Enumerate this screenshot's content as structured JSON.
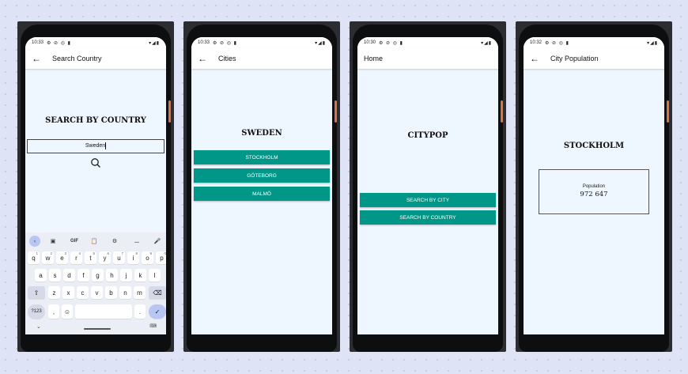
{
  "screens": [
    {
      "status": {
        "time": "10:33",
        "icons": "⚙ ⊘ ◎ ▮",
        "right": "▾◢▮"
      },
      "appbar": {
        "title": "Search Country"
      },
      "heading": "SEARCH BY COUNTRY",
      "search": {
        "value": "Sweden"
      },
      "keyboard": {
        "toolbar": [
          "GIF",
          "..."
        ],
        "row1": [
          [
            "q",
            "1"
          ],
          [
            "w",
            "2"
          ],
          [
            "e",
            "3"
          ],
          [
            "r",
            "4"
          ],
          [
            "t",
            "5"
          ],
          [
            "y",
            "6"
          ],
          [
            "u",
            "7"
          ],
          [
            "i",
            "8"
          ],
          [
            "o",
            "9"
          ],
          [
            "p",
            "0"
          ]
        ],
        "row2": [
          "a",
          "s",
          "d",
          "f",
          "g",
          "h",
          "j",
          "k",
          "l"
        ],
        "row3": [
          "z",
          "x",
          "c",
          "v",
          "b",
          "n",
          "m"
        ],
        "sym_label": "?123",
        "comma": ",",
        "period": "."
      }
    },
    {
      "status": {
        "time": "10:33",
        "icons": "⚙ ⊘ ◎ ▮",
        "right": "▾◢▮"
      },
      "appbar": {
        "title": "Cities"
      },
      "heading": "SWEDEN",
      "cities": [
        "STOCKHOLM",
        "GÖTEBORG",
        "MALMÖ"
      ]
    },
    {
      "status": {
        "time": "10:30",
        "icons": "⚙ ⊘ ◎ ▮",
        "right": "▾◢▮"
      },
      "appbar": {
        "title": "Home"
      },
      "heading": "CITYPOP",
      "buttons": {
        "by_city": "SEARCH BY CITY",
        "by_country": "SEARCH BY COUNTRY"
      }
    },
    {
      "status": {
        "time": "10:32",
        "icons": "⚙ ⊘ ◎ ▮",
        "right": "▾◢▮"
      },
      "appbar": {
        "title": "City Population"
      },
      "heading": "STOCKHOLM",
      "population": {
        "label": "Population",
        "value": "972 647"
      }
    }
  ],
  "colors": {
    "accent": "#009688",
    "screen_bg": "#eef6ff",
    "keyboard_bg": "#eceef5"
  }
}
